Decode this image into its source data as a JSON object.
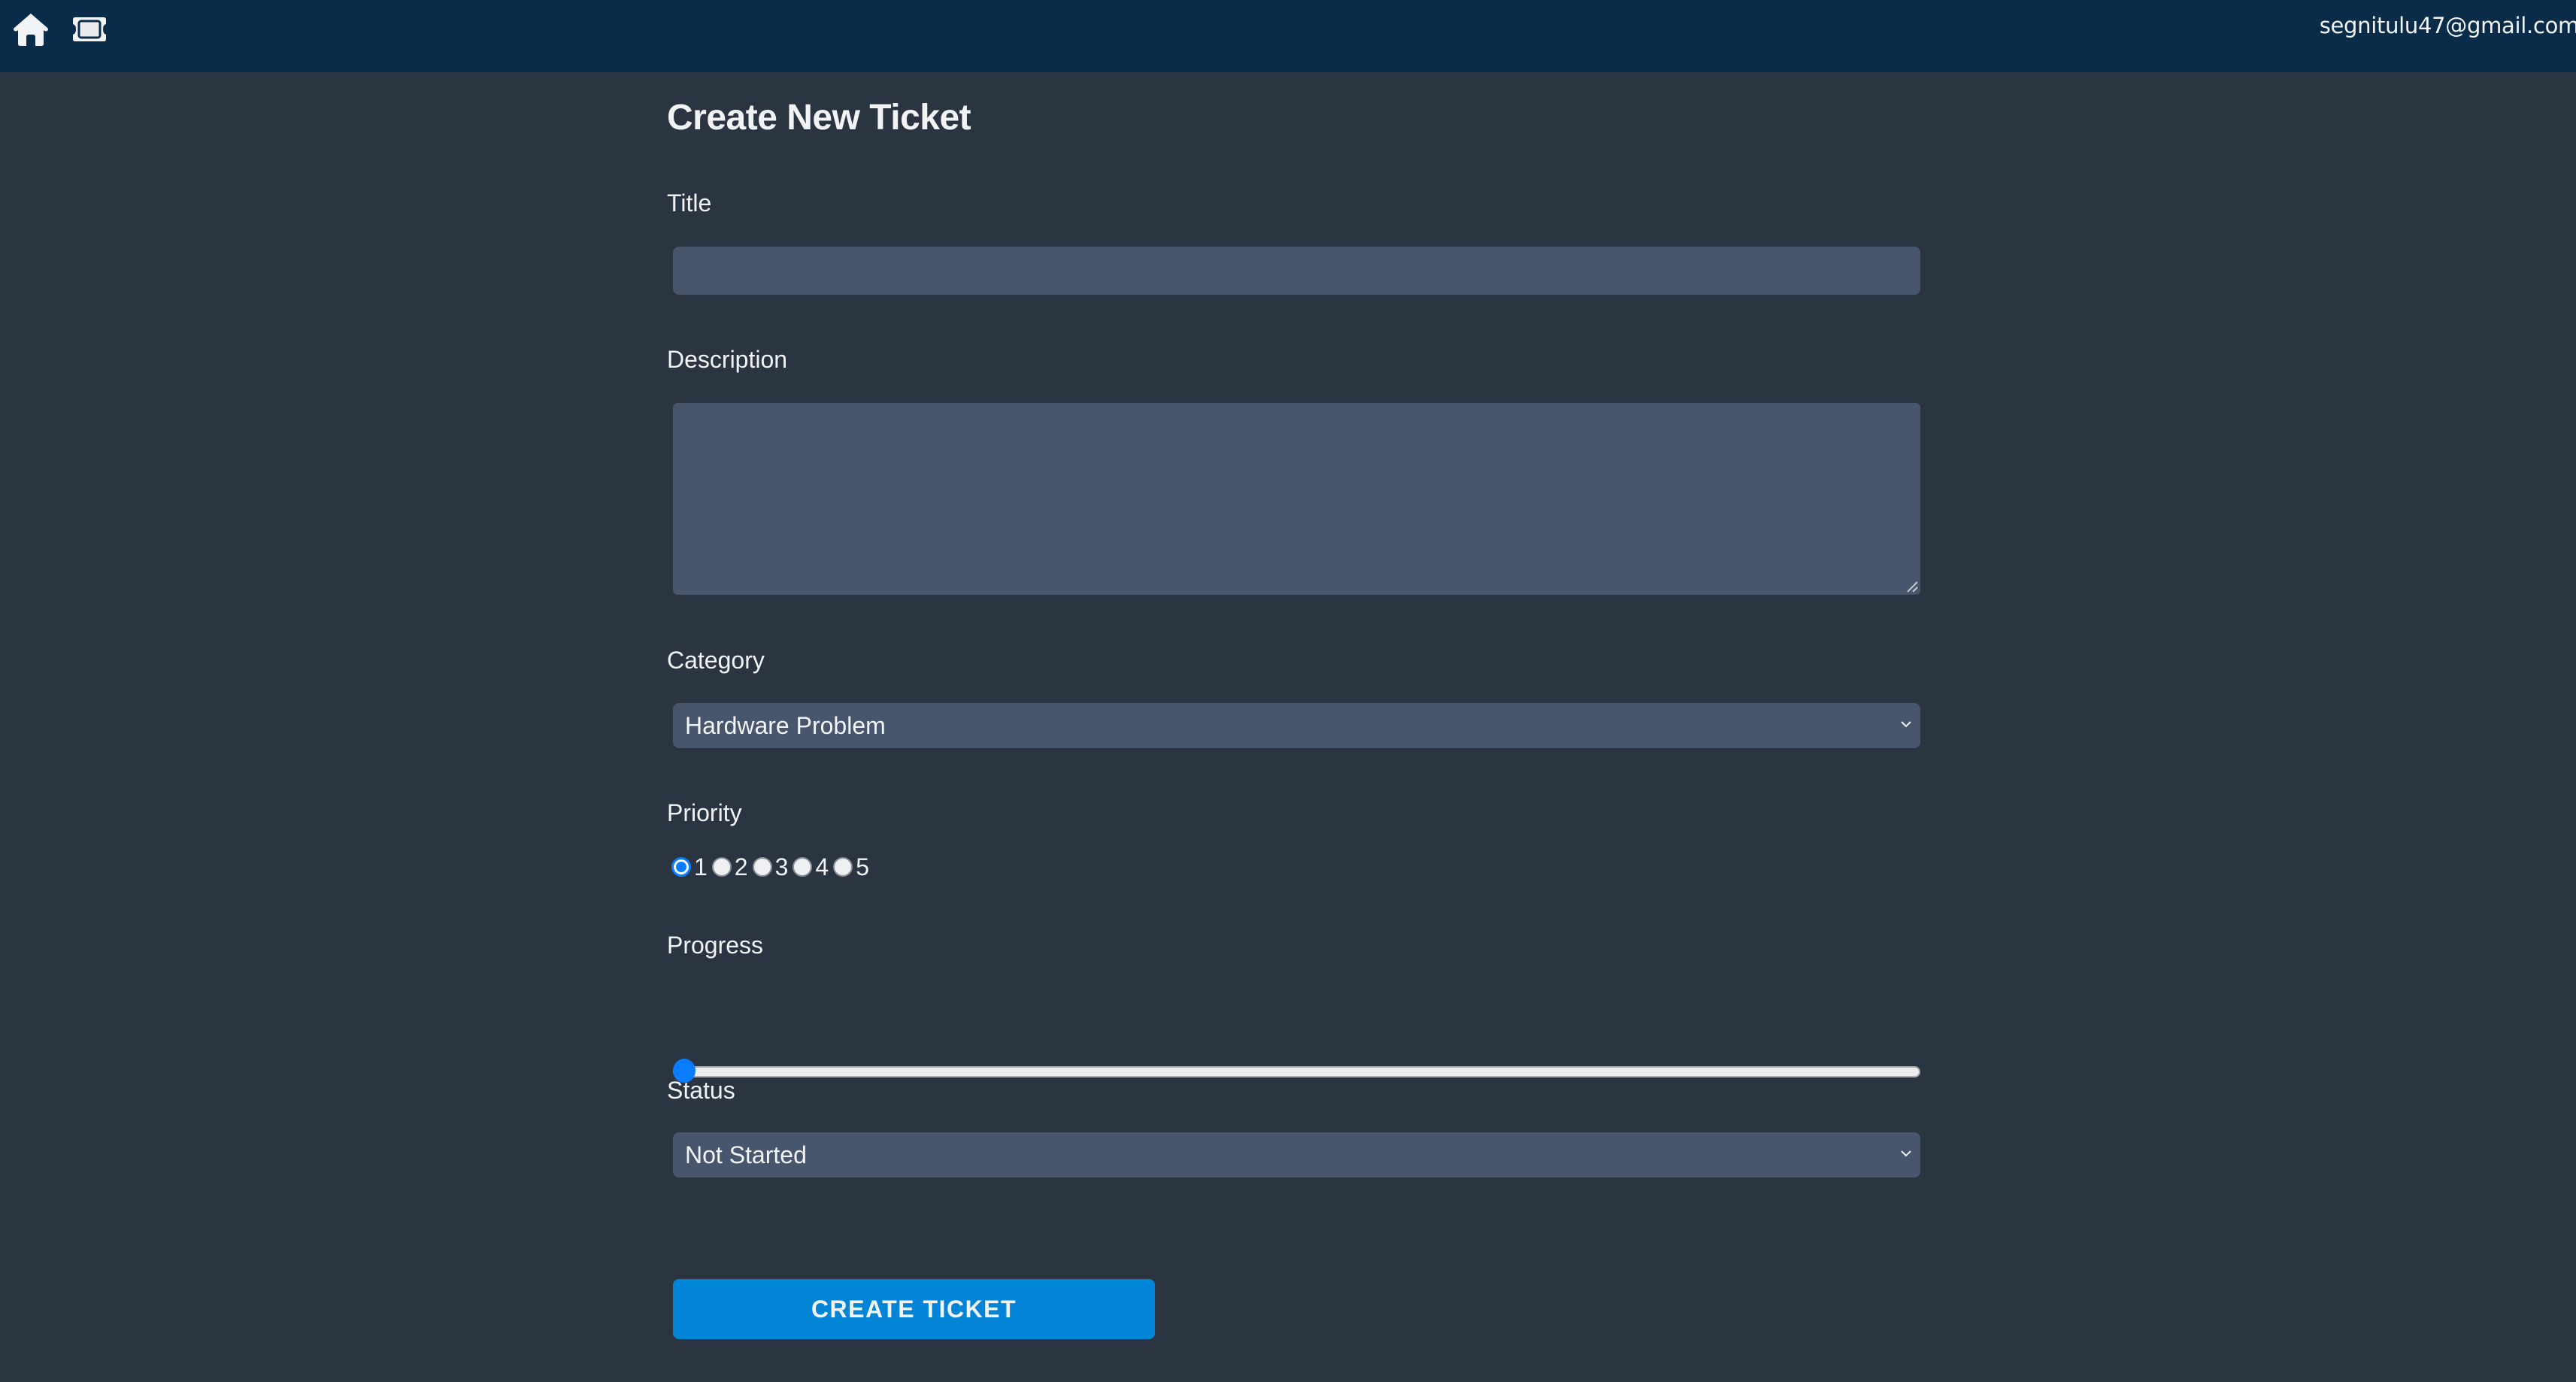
{
  "header": {
    "icons": [
      "home-icon",
      "ticket-icon"
    ],
    "user_email": "segnitulu47@gmail.com",
    "background_color": "#0a2c48"
  },
  "form": {
    "title": "Create New Ticket",
    "fields": {
      "title": {
        "label": "Title",
        "value": "",
        "placeholder": ""
      },
      "description": {
        "label": "Description",
        "value": "",
        "placeholder": ""
      },
      "category": {
        "label": "Category",
        "selected": "Hardware Problem"
      },
      "priority": {
        "label": "Priority",
        "options": [
          "1",
          "2",
          "3",
          "4",
          "5"
        ],
        "selected": "1"
      },
      "progress": {
        "label": "Progress",
        "value": 0,
        "min": 0,
        "max": 100
      },
      "status": {
        "label": "Status",
        "selected": "Not Started"
      }
    },
    "submit_label": "CREATE TICKET"
  },
  "colors": {
    "page_background": "#2b3441",
    "input_background": "#47566c",
    "accent": "#0a7cff",
    "button": "#0285d6"
  }
}
